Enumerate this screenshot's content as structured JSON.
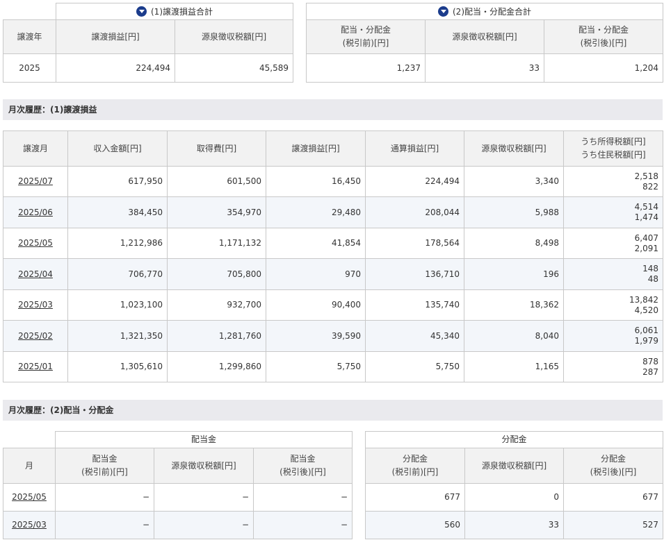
{
  "summary": {
    "transfer_title": "(1)譲渡損益合計",
    "dividend_title": "(2)配当・分配金合計",
    "headers": {
      "year": "譲渡年",
      "transfer_pl": "譲渡損益[円]",
      "withholding": "源泉徴収税額[円]",
      "div_before_1": "配当・分配金",
      "div_before_2": "(税引前)[円]",
      "div_withholding": "源泉徴収税額[円]",
      "div_after_1": "配当・分配金",
      "div_after_2": "(税引後)[円]"
    },
    "row": {
      "year": "2025",
      "transfer_pl": "224,494",
      "withholding": "45,589",
      "div_before": "1,237",
      "div_withholding": "33",
      "div_after": "1,204"
    }
  },
  "monthly_transfer": {
    "title": "月次履歴：(1)譲渡損益",
    "headers": {
      "month": "譲渡月",
      "income": "収入金額[円]",
      "cost": "取得費[円]",
      "pl": "譲渡損益[円]",
      "cumulative": "通算損益[円]",
      "withholding": "源泉徴収税額[円]",
      "tax_1": "うち所得税額[円]",
      "tax_2": "うち住民税額[円]"
    },
    "rows": [
      {
        "month": "2025/07",
        "income": "617,950",
        "cost": "601,500",
        "pl": "16,450",
        "cumulative": "224,494",
        "withholding": "3,340",
        "income_tax": "2,518",
        "resident_tax": "822"
      },
      {
        "month": "2025/06",
        "income": "384,450",
        "cost": "354,970",
        "pl": "29,480",
        "cumulative": "208,044",
        "withholding": "5,988",
        "income_tax": "4,514",
        "resident_tax": "1,474"
      },
      {
        "month": "2025/05",
        "income": "1,212,986",
        "cost": "1,171,132",
        "pl": "41,854",
        "cumulative": "178,564",
        "withholding": "8,498",
        "income_tax": "6,407",
        "resident_tax": "2,091"
      },
      {
        "month": "2025/04",
        "income": "706,770",
        "cost": "705,800",
        "pl": "970",
        "cumulative": "136,710",
        "withholding": "196",
        "income_tax": "148",
        "resident_tax": "48"
      },
      {
        "month": "2025/03",
        "income": "1,023,100",
        "cost": "932,700",
        "pl": "90,400",
        "cumulative": "135,740",
        "withholding": "18,362",
        "income_tax": "13,842",
        "resident_tax": "4,520"
      },
      {
        "month": "2025/02",
        "income": "1,321,350",
        "cost": "1,281,760",
        "pl": "39,590",
        "cumulative": "45,340",
        "withholding": "8,040",
        "income_tax": "6,061",
        "resident_tax": "1,979"
      },
      {
        "month": "2025/01",
        "income": "1,305,610",
        "cost": "1,299,860",
        "pl": "5,750",
        "cumulative": "5,750",
        "withholding": "1,165",
        "income_tax": "878",
        "resident_tax": "287"
      }
    ]
  },
  "monthly_dividend": {
    "title": "月次履歴：(2)配当・分配金",
    "dividend_group": "配当金",
    "distribution_group": "分配金",
    "headers": {
      "month": "月",
      "div_before_1": "配当金",
      "div_before_2": "(税引前)[円]",
      "div_withholding": "源泉徴収税額[円]",
      "div_after_1": "配当金",
      "div_after_2": "(税引後)[円]",
      "dist_before_1": "分配金",
      "dist_before_2": "(税引前)[円]",
      "dist_withholding": "源泉徴収税額[円]",
      "dist_after_1": "分配金",
      "dist_after_2": "(税引後)[円]"
    },
    "rows": [
      {
        "month": "2025/05",
        "div_before": "−",
        "div_withholding": "−",
        "div_after": "−",
        "dist_before": "677",
        "dist_withholding": "0",
        "dist_after": "677"
      },
      {
        "month": "2025/03",
        "div_before": "−",
        "div_withholding": "−",
        "div_after": "−",
        "dist_before": "560",
        "dist_withholding": "33",
        "dist_after": "527"
      }
    ]
  }
}
